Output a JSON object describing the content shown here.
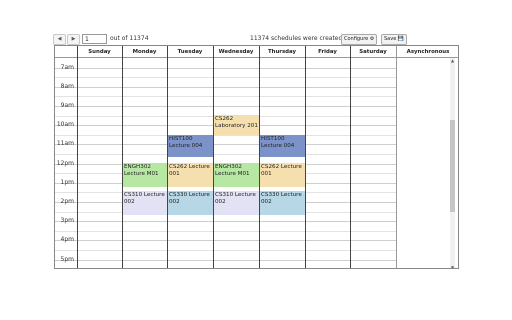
{
  "toolbar": {
    "prev_label": "◀",
    "next_label": "▶",
    "page_value": "1",
    "out_of": "out of 11374",
    "created": "11374 schedules were created",
    "configure_label": "Configure ⚙",
    "save_label": "Save 💾"
  },
  "days": [
    "Sunday",
    "Monday",
    "Tuesday",
    "Wednesday",
    "Thursday",
    "Friday",
    "Saturday",
    "Asynchronous"
  ],
  "hours": [
    "7am",
    "8am",
    "9am",
    "10am",
    "11am",
    "12pm",
    "1pm",
    "2pm",
    "3pm",
    "4pm",
    "5pm"
  ],
  "blocks": [
    {
      "day": "Tuesday",
      "line1": "HIST100",
      "line2": "Lecture 004",
      "color": "#7b93c9"
    },
    {
      "day": "Thursday",
      "line1": "HIST100",
      "line2": "Lecture 004",
      "color": "#7b93c9"
    },
    {
      "day": "Wednesday",
      "line1": "CS262",
      "line2": "Laboratory 201",
      "color": "#f6dfae"
    },
    {
      "day": "Monday",
      "line1": "ENGH302",
      "line2": "Lecture M01",
      "color": "#b6e8a4"
    },
    {
      "day": "Wednesday",
      "line1": "ENGH302",
      "line2": "Lecture M01",
      "color": "#b6e8a4"
    },
    {
      "day": "Tuesday",
      "line1": "CS262 Lecture",
      "line2": "001",
      "color": "#f6dfae"
    },
    {
      "day": "Thursday",
      "line1": "CS262 Lecture",
      "line2": "001",
      "color": "#f6dfae"
    },
    {
      "day": "Monday",
      "line1": "CS310 Lecture",
      "line2": "002",
      "color": "#e3e2f4"
    },
    {
      "day": "Wednesday",
      "line1": "CS310 Lecture",
      "line2": "002",
      "color": "#e3e2f4"
    },
    {
      "day": "Tuesday",
      "line1": "CS330 Lecture",
      "line2": "002",
      "color": "#b7d7e6"
    },
    {
      "day": "Thursday",
      "line1": "CS330 Lecture",
      "line2": "002",
      "color": "#b7d7e6"
    }
  ]
}
